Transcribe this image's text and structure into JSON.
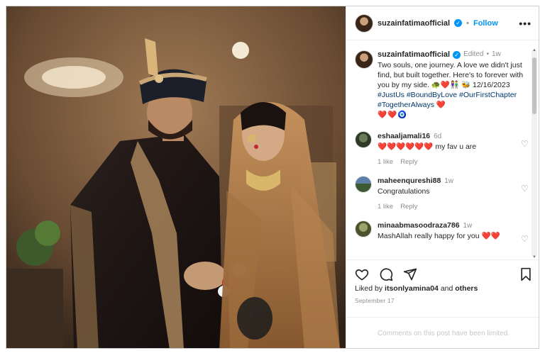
{
  "post": {
    "username": "suzainfatimaofficial",
    "follow_label": "Follow",
    "separator": "•",
    "more_label": "•••",
    "verified_glyph": "✓",
    "photo_alt_icon": "wedding-photo"
  },
  "caption": {
    "username": "suzainfatimaofficial",
    "edited": "Edited",
    "time": "1w",
    "text": "Two souls, one journey. A love we didn't just find, but built together. Here's to forever with you by my side. 🐢❤️👫",
    "line2_prefix": "🐝 12/16/2023 ",
    "tags": "#JustUs #BoundByLove #OurFirstChapter #TogetherAlways",
    "tags_suffix": "❤️",
    "trailing": "❤️❤️🧿"
  },
  "comments": [
    {
      "user": "eshaaljamali16",
      "time": "6d",
      "text": "❤️❤️❤️❤️❤️❤️ my fav u are",
      "likes": "1 like",
      "reply": "Reply"
    },
    {
      "user": "maheenqureshi88",
      "time": "1w",
      "text": "Congratulations",
      "likes": "1 like",
      "reply": "Reply"
    },
    {
      "user": "minaabmasoodraza786",
      "time": "1w",
      "text": "MashAllah really happy for you ❤️❤️",
      "likes": "",
      "reply": ""
    }
  ],
  "like_glyph": "♡",
  "footer": {
    "liked_by_prefix": "Liked by ",
    "liked_by_user": "itsonlyamina04",
    "liked_by_suffix": " and ",
    "liked_by_others": "others",
    "date": "September 17",
    "comments_limited": "Comments on this post have been limited."
  },
  "colors": {
    "accent": "#0095f6",
    "heart": "#ed4956",
    "muted": "#8e8e8e"
  }
}
